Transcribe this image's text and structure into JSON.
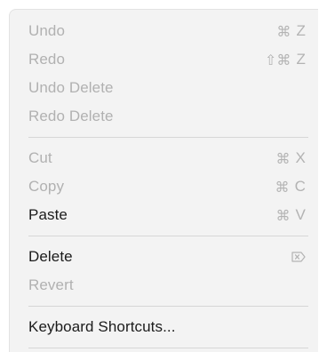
{
  "menu": {
    "items": [
      {
        "label": "Undo",
        "shortcut_mods": "⌘",
        "shortcut_key": "Z",
        "enabled": false
      },
      {
        "label": "Redo",
        "shortcut_mods": "⇧⌘",
        "shortcut_key": "Z",
        "enabled": false
      },
      {
        "label": "Undo Delete",
        "enabled": false
      },
      {
        "label": "Redo Delete",
        "enabled": false
      },
      {
        "label": "Cut",
        "shortcut_mods": "⌘",
        "shortcut_key": "X",
        "enabled": false
      },
      {
        "label": "Copy",
        "shortcut_mods": "⌘",
        "shortcut_key": "C",
        "enabled": false
      },
      {
        "label": "Paste",
        "shortcut_mods": "⌘",
        "shortcut_key": "V",
        "enabled": true
      },
      {
        "label": "Delete",
        "shortcut_icon": "delete-forward-icon",
        "enabled": true
      },
      {
        "label": "Revert",
        "enabled": false
      },
      {
        "label": "Keyboard Shortcuts...",
        "enabled": true
      }
    ]
  },
  "colors": {
    "menu_background": "#f3f3f3",
    "enabled_text": "#1b1b1b",
    "disabled_text": "#b1b1b1",
    "separator": "#d6d6d6"
  }
}
